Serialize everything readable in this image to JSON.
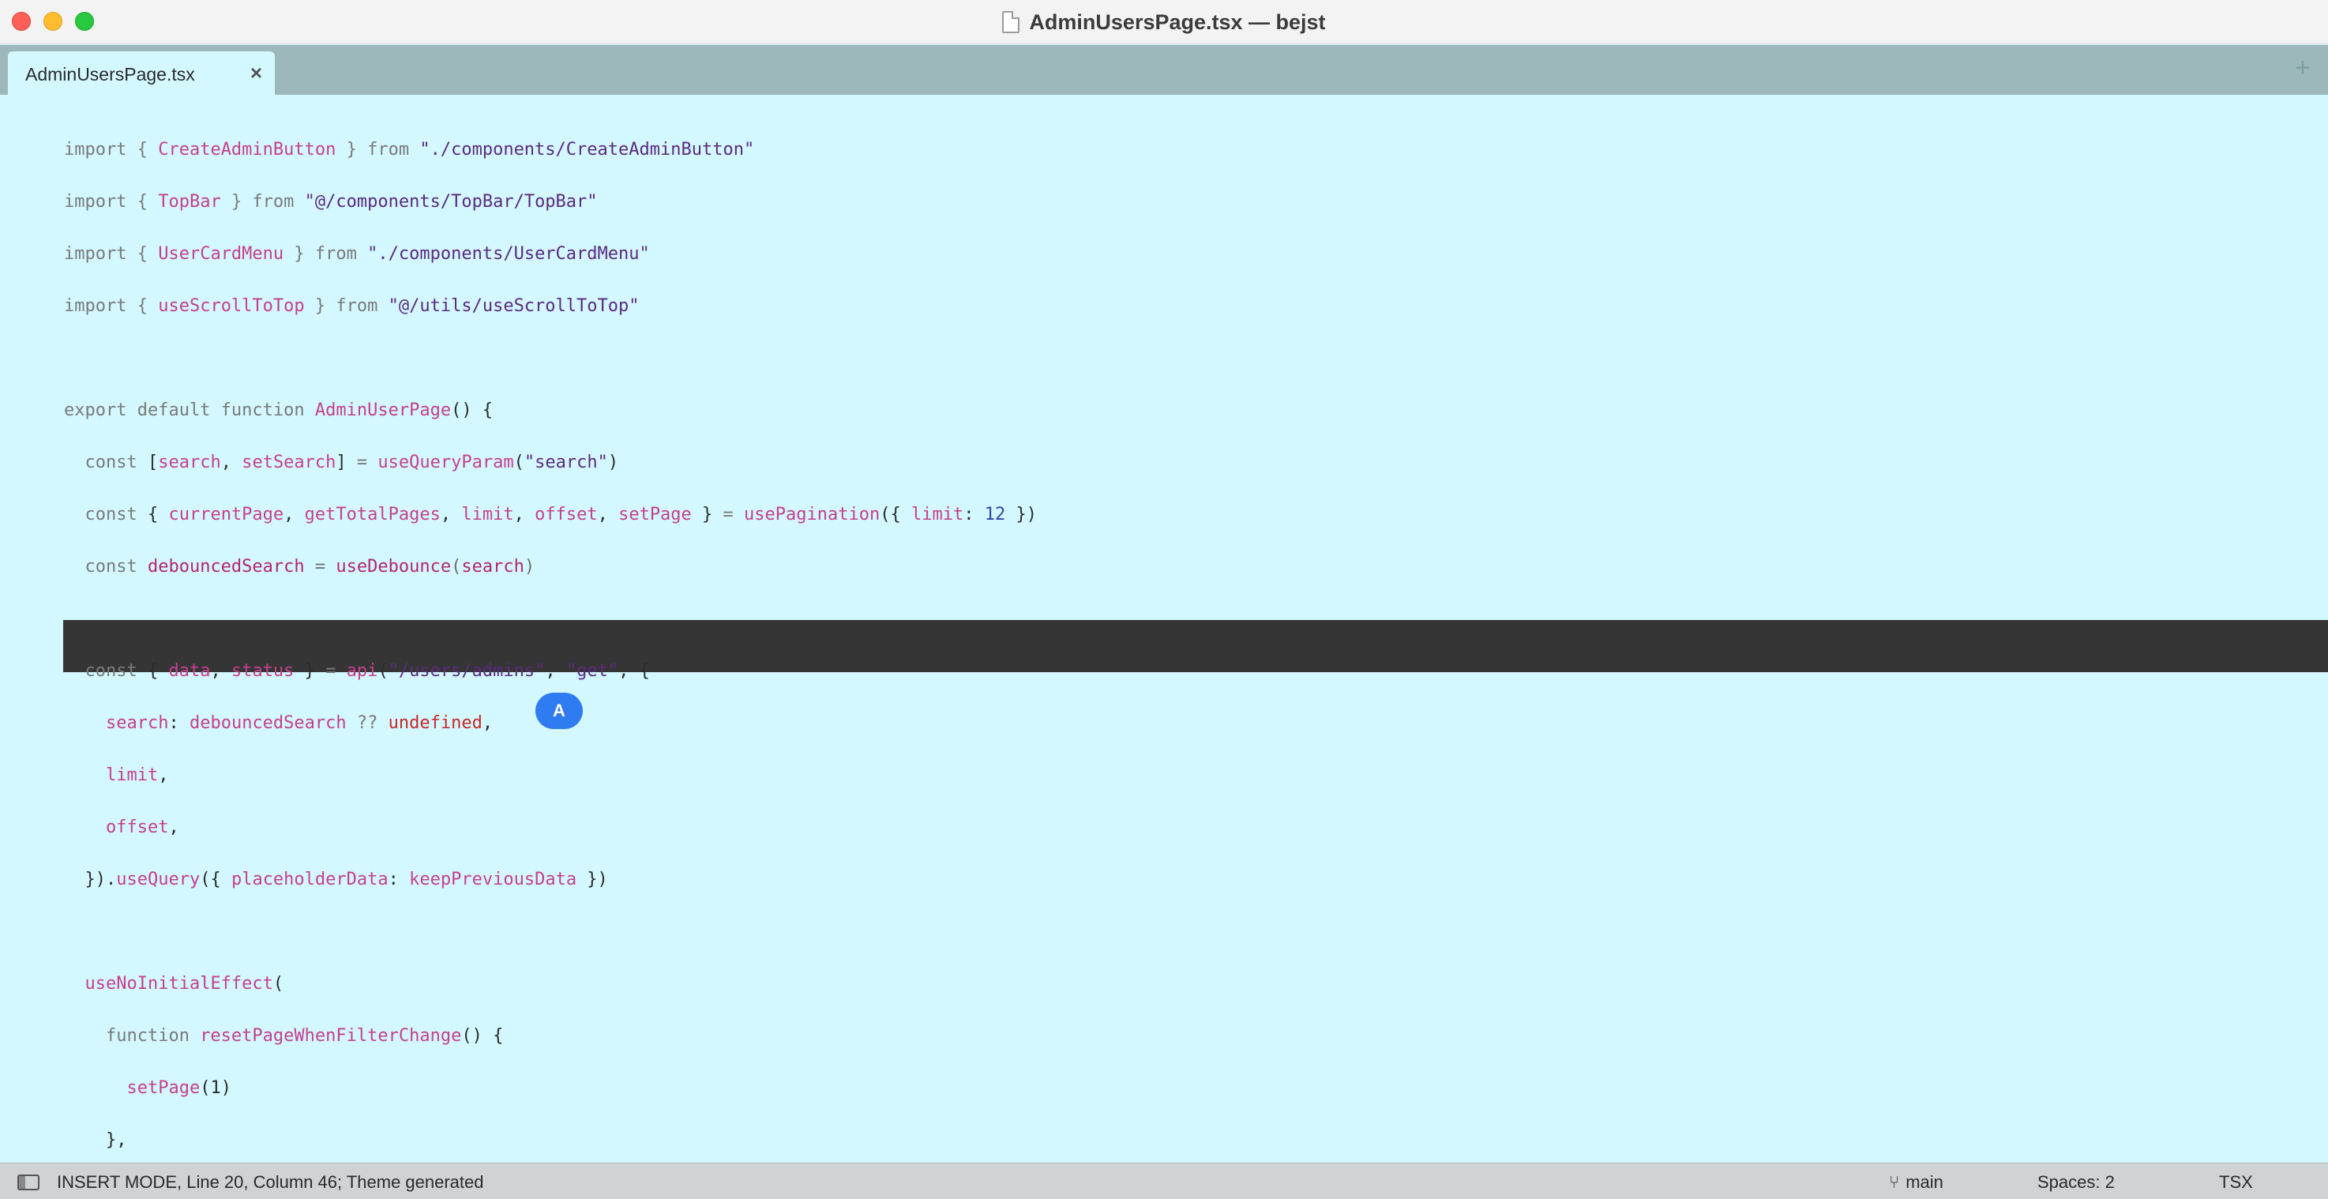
{
  "window": {
    "title": "AdminUsersPage.tsx — bejst"
  },
  "tabs": [
    {
      "label": "AdminUsersPage.tsx",
      "close_icon": "×"
    }
  ],
  "tabbar": {
    "add_icon": "+"
  },
  "editor": {
    "lines": [
      {
        "tokens": [
          [
            "kw",
            "import { "
          ],
          [
            "fn",
            "CreateAdminButton"
          ],
          [
            "kw",
            " } from "
          ],
          [
            "str",
            "\"./components/CreateAdminButton\""
          ]
        ]
      },
      {
        "tokens": [
          [
            "kw",
            "import { "
          ],
          [
            "fn",
            "TopBar"
          ],
          [
            "kw",
            " } from "
          ],
          [
            "str",
            "\"@/components/TopBar/TopBar\""
          ]
        ]
      },
      {
        "tokens": [
          [
            "kw",
            "import { "
          ],
          [
            "fn",
            "UserCardMenu"
          ],
          [
            "kw",
            " } from "
          ],
          [
            "str",
            "\"./components/UserCardMenu\""
          ]
        ]
      },
      {
        "tokens": [
          [
            "kw",
            "import { "
          ],
          [
            "fn",
            "useScrollToTop"
          ],
          [
            "kw",
            " } from "
          ],
          [
            "str",
            "\"@/utils/useScrollToTop\""
          ]
        ]
      },
      {
        "tokens": []
      },
      {
        "tokens": [
          [
            "kw",
            "export default function "
          ],
          [
            "fn",
            "AdminUserPage"
          ],
          [
            "",
            "() {"
          ]
        ]
      },
      {
        "tokens": [
          [
            "kw",
            "  const "
          ],
          [
            "",
            "["
          ],
          [
            "fn",
            "search"
          ],
          [
            "",
            ", "
          ],
          [
            "fn",
            "setSearch"
          ],
          [
            "",
            "] "
          ],
          [
            "op",
            "= "
          ],
          [
            "fn",
            "useQueryParam"
          ],
          [
            "",
            "("
          ],
          [
            "str",
            "\"search\""
          ],
          [
            "",
            ")"
          ]
        ]
      },
      {
        "tokens": [
          [
            "kw",
            "  const "
          ],
          [
            "",
            "{ "
          ],
          [
            "fn",
            "currentPage"
          ],
          [
            "",
            ", "
          ],
          [
            "fn",
            "getTotalPages"
          ],
          [
            "",
            ", "
          ],
          [
            "fn",
            "limit"
          ],
          [
            "",
            ", "
          ],
          [
            "fn",
            "offset"
          ],
          [
            "",
            ", "
          ],
          [
            "fn",
            "setPage"
          ],
          [
            "",
            " } "
          ],
          [
            "op",
            "= "
          ],
          [
            "fn",
            "usePagination"
          ],
          [
            "",
            "({ "
          ],
          [
            "fn",
            "limit"
          ],
          [
            "",
            ": "
          ],
          [
            "num",
            "12"
          ],
          [
            "",
            " })"
          ]
        ]
      },
      {
        "highlight": true,
        "tokens": [
          [
            "kw",
            "  const "
          ],
          [
            "fn",
            "debouncedSearch"
          ],
          [
            "op",
            " = "
          ],
          [
            "fn",
            "useDebounce"
          ],
          [
            "",
            "("
          ],
          [
            "fn",
            "search"
          ],
          [
            "",
            ")"
          ]
        ]
      },
      {
        "tokens": []
      },
      {
        "tokens": [
          [
            "kw",
            "  const "
          ],
          [
            "",
            "{ "
          ],
          [
            "fn",
            "data"
          ],
          [
            "",
            ", "
          ],
          [
            "fn",
            "status"
          ],
          [
            "",
            " } "
          ],
          [
            "op",
            "= "
          ],
          [
            "fn",
            "api"
          ],
          [
            "",
            "("
          ],
          [
            "str",
            "\"/users/admins\""
          ],
          [
            "",
            ", "
          ],
          [
            "str",
            "\"get\""
          ],
          [
            "",
            ", {"
          ]
        ]
      },
      {
        "tokens": [
          [
            "",
            "    "
          ],
          [
            "fn",
            "search"
          ],
          [
            "",
            ": "
          ],
          [
            "fn",
            "debouncedSearch"
          ],
          [
            "op",
            " ?? "
          ],
          [
            "undef",
            "undefined"
          ],
          [
            "",
            ","
          ]
        ]
      },
      {
        "tokens": [
          [
            "",
            "    "
          ],
          [
            "fn",
            "limit"
          ],
          [
            "",
            ","
          ]
        ]
      },
      {
        "tokens": [
          [
            "",
            "    "
          ],
          [
            "fn",
            "offset"
          ],
          [
            "",
            ","
          ]
        ]
      },
      {
        "tokens": [
          [
            "",
            "  })."
          ],
          [
            "fn",
            "useQuery"
          ],
          [
            "",
            "({ "
          ],
          [
            "fn",
            "placeholderData"
          ],
          [
            "",
            ": "
          ],
          [
            "fn",
            "keepPreviousData"
          ],
          [
            "",
            " })"
          ]
        ]
      },
      {
        "tokens": []
      },
      {
        "tokens": [
          [
            "",
            "  "
          ],
          [
            "fn",
            "useNoInitialEffect"
          ],
          [
            "",
            "("
          ]
        ]
      },
      {
        "tokens": [
          [
            "kw",
            "    function "
          ],
          [
            "fn",
            "resetPageWhenFilterChange"
          ],
          [
            "",
            "() {"
          ]
        ]
      },
      {
        "tokens": [
          [
            "",
            "      "
          ],
          [
            "fn",
            "setPage"
          ],
          [
            "",
            "(1)"
          ]
        ]
      },
      {
        "tokens": [
          [
            "",
            "    },"
          ]
        ]
      }
    ],
    "collaborator_cursor": "A"
  },
  "statusbar": {
    "mode": "INSERT MODE, Line 20, Column 46; Theme generated",
    "branch": "main",
    "spaces": "Spaces: 2",
    "language": "TSX"
  }
}
